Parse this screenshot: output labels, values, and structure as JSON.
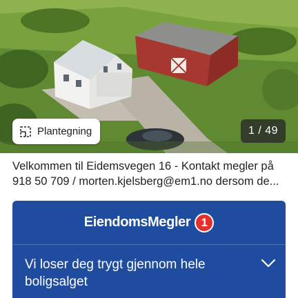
{
  "listing": {
    "floorplan_label": "Plantegning",
    "photo_counter": "1 / 49",
    "description_line1": "Velkommen til Eidemsvegen 16 - Kontakt megler på",
    "description_line2": "918 50 709 / morten.kjelsberg@em1.no dersom de..."
  },
  "broker": {
    "logo_text": "EiendomsMegler",
    "logo_badge": "1",
    "tagline": "Vi loser deg trygt gjennom hele boligsalget",
    "brand_color": "#1f4c9e",
    "badge_color": "#e2302f"
  },
  "icons": {
    "floorplan": "floorplan-icon",
    "expand": "chevron-down-icon"
  }
}
